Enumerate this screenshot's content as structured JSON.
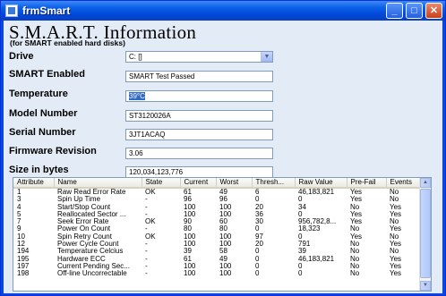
{
  "window": {
    "title": "frmSmart",
    "buttons": {
      "minimize": "_",
      "maximize": "□",
      "close": "✕"
    }
  },
  "header": {
    "title": "S.M.A.R.T. Information",
    "subtitle": "(for SMART enabled hard disks)"
  },
  "drive": {
    "label": "Drive",
    "value": "C: []"
  },
  "fields": [
    {
      "label": "SMART Enabled",
      "value": "SMART Test Passed",
      "selected": false
    },
    {
      "label": "Temperature",
      "value": "39°C",
      "selected": true
    },
    {
      "label": "Model Number",
      "value": "ST3120026A",
      "selected": false
    },
    {
      "label": "Serial Number",
      "value": "3JT1ACAQ",
      "selected": false
    },
    {
      "label": "Firmware Revision",
      "value": "3.06",
      "selected": false
    },
    {
      "label": "Size in bytes",
      "value": "120,034,123,776",
      "selected": false
    }
  ],
  "table": {
    "columns": [
      "Attribute",
      "Name",
      "State",
      "Current",
      "Worst",
      "Thresh...",
      "Raw Value",
      "Pre-Fail",
      "Events"
    ],
    "rows": [
      [
        "1",
        "Raw Read Error Rate",
        "OK",
        "61",
        "49",
        "6",
        "46,183,821",
        "Yes",
        "No"
      ],
      [
        "3",
        "Spin Up Time",
        "-",
        "96",
        "96",
        "0",
        "0",
        "Yes",
        "No"
      ],
      [
        "4",
        "Start/Stop Count",
        "-",
        "100",
        "100",
        "20",
        "34",
        "No",
        "Yes"
      ],
      [
        "5",
        "Reallocated Sector ...",
        "-",
        "100",
        "100",
        "36",
        "0",
        "Yes",
        "Yes"
      ],
      [
        "7",
        "Seek Error Rate",
        "OK",
        "90",
        "60",
        "30",
        "956,782,8...",
        "Yes",
        "No"
      ],
      [
        "9",
        "Power On Count",
        "-",
        "80",
        "80",
        "0",
        "18,323",
        "No",
        "Yes"
      ],
      [
        "10",
        "Spin Retry Count",
        "OK",
        "100",
        "100",
        "97",
        "0",
        "Yes",
        "No"
      ],
      [
        "12",
        "Power Cycle Count",
        "-",
        "100",
        "100",
        "20",
        "791",
        "No",
        "Yes"
      ],
      [
        "194",
        "Temperature Celcius",
        "-",
        "39",
        "58",
        "0",
        "39",
        "No",
        "No"
      ],
      [
        "195",
        "Hardware ECC",
        "-",
        "61",
        "49",
        "0",
        "46,183,821",
        "No",
        "Yes"
      ],
      [
        "197",
        "Current Pending Sec...",
        "-",
        "100",
        "100",
        "0",
        "0",
        "No",
        "Yes"
      ],
      [
        "198",
        "Off-line Uncorrectable",
        "-",
        "100",
        "100",
        "0",
        "0",
        "No",
        "Yes"
      ]
    ]
  },
  "colors": {
    "titlebar": "#0a5fe6",
    "client_bg": "#e3ecf6",
    "selection": "#316ac5"
  },
  "icons": {
    "app": "window-app-icon",
    "dropdown": "chevron-down-icon",
    "scroll_up": "scroll-up-arrow-icon",
    "scroll_down": "scroll-down-arrow-icon"
  }
}
